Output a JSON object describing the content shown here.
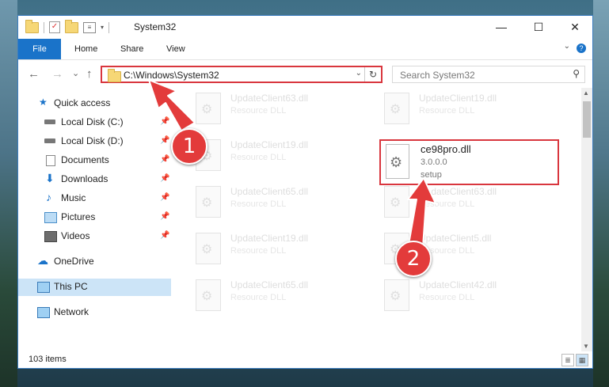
{
  "window": {
    "title": "System32",
    "minimize_icon": "—",
    "maximize_icon": "☐",
    "close_icon": "✕"
  },
  "ribbon": {
    "file": "File",
    "home": "Home",
    "share": "Share",
    "view": "View",
    "help": "?"
  },
  "nav": {
    "back": "←",
    "forward": "→",
    "recent": "⌄",
    "up": "↑"
  },
  "address": {
    "path": "C:\\Windows\\System32"
  },
  "search": {
    "placeholder": "Search System32"
  },
  "sidebar": {
    "items": [
      {
        "label": "Quick access"
      },
      {
        "label": "Local Disk (C:)"
      },
      {
        "label": "Local Disk (D:)"
      },
      {
        "label": "Documents"
      },
      {
        "label": "Downloads"
      },
      {
        "label": "Music"
      },
      {
        "label": "Pictures"
      },
      {
        "label": "Videos"
      },
      {
        "label": "OneDrive"
      },
      {
        "label": "This PC"
      },
      {
        "label": "Network"
      }
    ]
  },
  "files": [
    {
      "name": "UpdateClient63.dll",
      "type": "Resource DLL"
    },
    {
      "name": "UpdateClient19.dll",
      "type": "Resource DLL"
    },
    {
      "name": "UpdateClient19.dll",
      "type": "Resource DLL"
    },
    {
      "name": "UpdateClient65.dll",
      "type": "Resource DLL"
    },
    {
      "name": "UpdateClient63.dll",
      "type": "Resource DLL"
    },
    {
      "name": "UpdateClient19.dll",
      "type": "Resource DLL"
    },
    {
      "name": "UpdateClient5.dll",
      "type": "Resource DLL"
    },
    {
      "name": "UpdateClient65.dll",
      "type": "Resource DLL"
    },
    {
      "name": "UpdateClient42.dll",
      "type": "Resource DLL"
    }
  ],
  "highlighted_file": {
    "name": "ce98pro.dll",
    "version": "3.0.0.0",
    "type": "setup"
  },
  "status": {
    "count": "103 items"
  },
  "markers": {
    "one": "1",
    "two": "2"
  },
  "colors": {
    "accent": "#1a73c9",
    "highlight": "#d9363e",
    "marker": "#e33b3b"
  }
}
